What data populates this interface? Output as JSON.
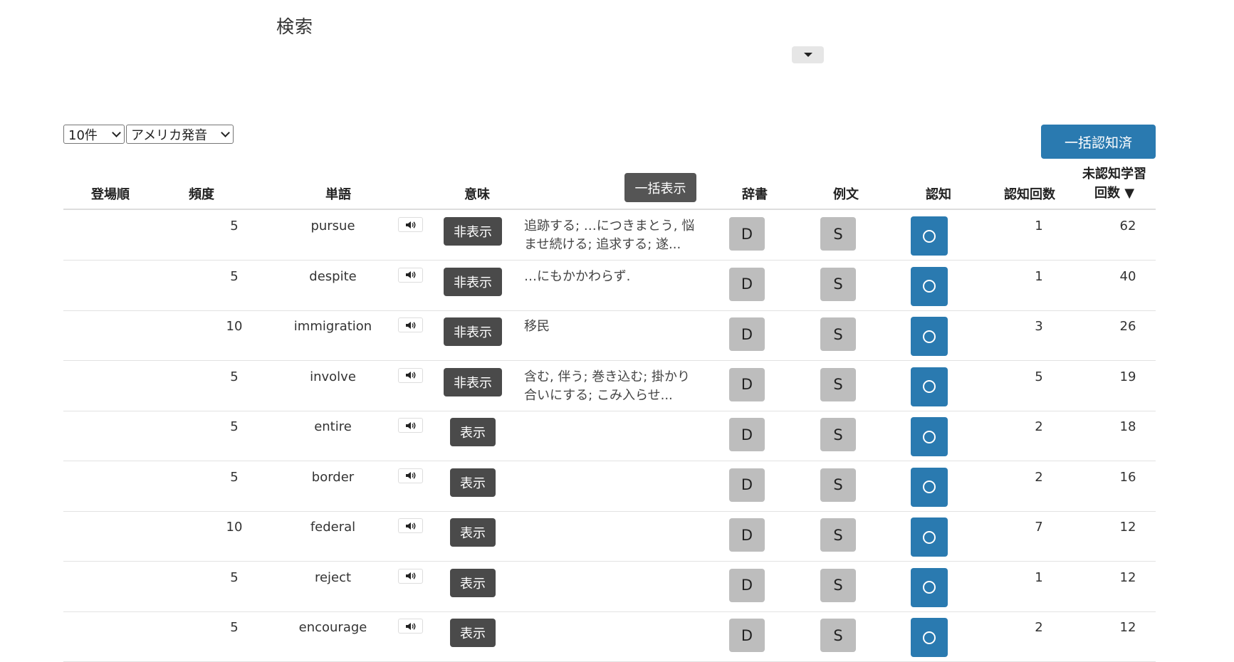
{
  "page": {
    "title": "検索"
  },
  "controls": {
    "count_select": "10件",
    "voice_select": "アメリカ発音",
    "bulk_known_label": "一括認知済",
    "bulk_show_label": "一括表示"
  },
  "columns": {
    "order": "登場順",
    "freq": "頻度",
    "word": "単語",
    "meaning": "意味",
    "dict": "辞書",
    "example": "例文",
    "know": "認知",
    "know_count": "認知回数",
    "unknown_count": "未認知学習回数 ▼"
  },
  "buttons": {
    "hide": "非表示",
    "show": "表示",
    "dict": "D",
    "example": "S"
  },
  "icons": {
    "audio": "speaker-icon",
    "know": "circle-icon",
    "dropdown": "caret-down-icon"
  },
  "colors": {
    "primary": "#2a7ab0",
    "dark_button": "#4a4a4a",
    "gray_button": "#bdbdbd"
  },
  "rows": [
    {
      "freq": "5",
      "word": "pursue",
      "toggle": "非表示",
      "meaning": "追跡する; …につきまとう, 悩ませ続ける; 追求する; 遂...",
      "know_count": "1",
      "unknown_count": "62"
    },
    {
      "freq": "5",
      "word": "despite",
      "toggle": "非表示",
      "meaning": "…にもかかわらず.",
      "know_count": "1",
      "unknown_count": "40"
    },
    {
      "freq": "10",
      "word": "immigration",
      "toggle": "非表示",
      "meaning": "移民",
      "know_count": "3",
      "unknown_count": "26"
    },
    {
      "freq": "5",
      "word": "involve",
      "toggle": "非表示",
      "meaning": "含む, 伴う; 巻き込む; 掛かり合いにする; こみ入らせ...",
      "know_count": "5",
      "unknown_count": "19"
    },
    {
      "freq": "5",
      "word": "entire",
      "toggle": "表示",
      "meaning": "",
      "know_count": "2",
      "unknown_count": "18"
    },
    {
      "freq": "5",
      "word": "border",
      "toggle": "表示",
      "meaning": "",
      "know_count": "2",
      "unknown_count": "16"
    },
    {
      "freq": "10",
      "word": "federal",
      "toggle": "表示",
      "meaning": "",
      "know_count": "7",
      "unknown_count": "12"
    },
    {
      "freq": "5",
      "word": "reject",
      "toggle": "表示",
      "meaning": "",
      "know_count": "1",
      "unknown_count": "12"
    },
    {
      "freq": "5",
      "word": "encourage",
      "toggle": "表示",
      "meaning": "",
      "know_count": "2",
      "unknown_count": "12"
    }
  ]
}
